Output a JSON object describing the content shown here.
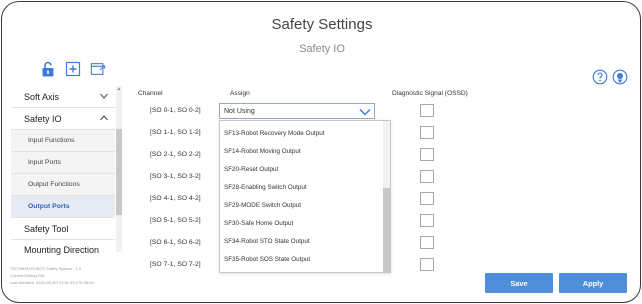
{
  "header": {
    "title": "Safety Settings",
    "subtitle": "Safety IO"
  },
  "toolbar": {
    "icons": [
      "unlock-icon",
      "add-file-icon",
      "open-file-icon"
    ]
  },
  "top_right": {
    "help_icon": "question-circle-icon",
    "view_icon": "eye-icon"
  },
  "sidebar": {
    "items": [
      {
        "label": "Soft Axis",
        "expanded": false
      },
      {
        "label": "Safety IO",
        "expanded": true
      },
      {
        "label": "Input Functions"
      },
      {
        "label": "Input Ports"
      },
      {
        "label": "Output Functions"
      },
      {
        "label": "Output Ports",
        "active": true
      },
      {
        "label": "Safety Tool"
      },
      {
        "label": "Mounting Direction"
      }
    ],
    "meta": {
      "system": "TECHMAN ROBOT Safety System : 1.3",
      "editing": "Current Editing File:",
      "modified": "Last Modified: 2020-08-30T13:51:53.279-08:00"
    }
  },
  "table": {
    "headers": {
      "channel": "Channel",
      "assign": "Assign",
      "diagnostic": "Diagnostic Signal (OSSD)"
    },
    "rows": [
      {
        "channel": "[SO 0-1, SO 0-2]"
      },
      {
        "channel": "[SO 1-1, SO 1-2]"
      },
      {
        "channel": "[SO 2-1, SO 2-2]"
      },
      {
        "channel": "[SO 3-1, SO 3-2]"
      },
      {
        "channel": "[SO 4-1, SO 4-2]"
      },
      {
        "channel": "[SO 5-1, SO 5-2]"
      },
      {
        "channel": "[SO 6-1, SO 6-2]"
      },
      {
        "channel": "[SO 7-1, SO 7-2]"
      }
    ],
    "select_value": "Not Using",
    "options": [
      "SF13-Robot Recovery Mode Output",
      "SF14-Robot Moving Output",
      "SF20-Reset Output",
      "SF28-Enabling Switch Output",
      "SF29-MODE Switch Output",
      "SF30-Safe Home Output",
      "SF34-Robot STO State Output",
      "SF35-Robot SOS State Output"
    ]
  },
  "buttons": {
    "save": "Save",
    "apply": "Apply"
  },
  "colors": {
    "accent": "#4f8fd8",
    "active_text": "#2f66b3",
    "icon_blue": "#3b7dd8"
  }
}
